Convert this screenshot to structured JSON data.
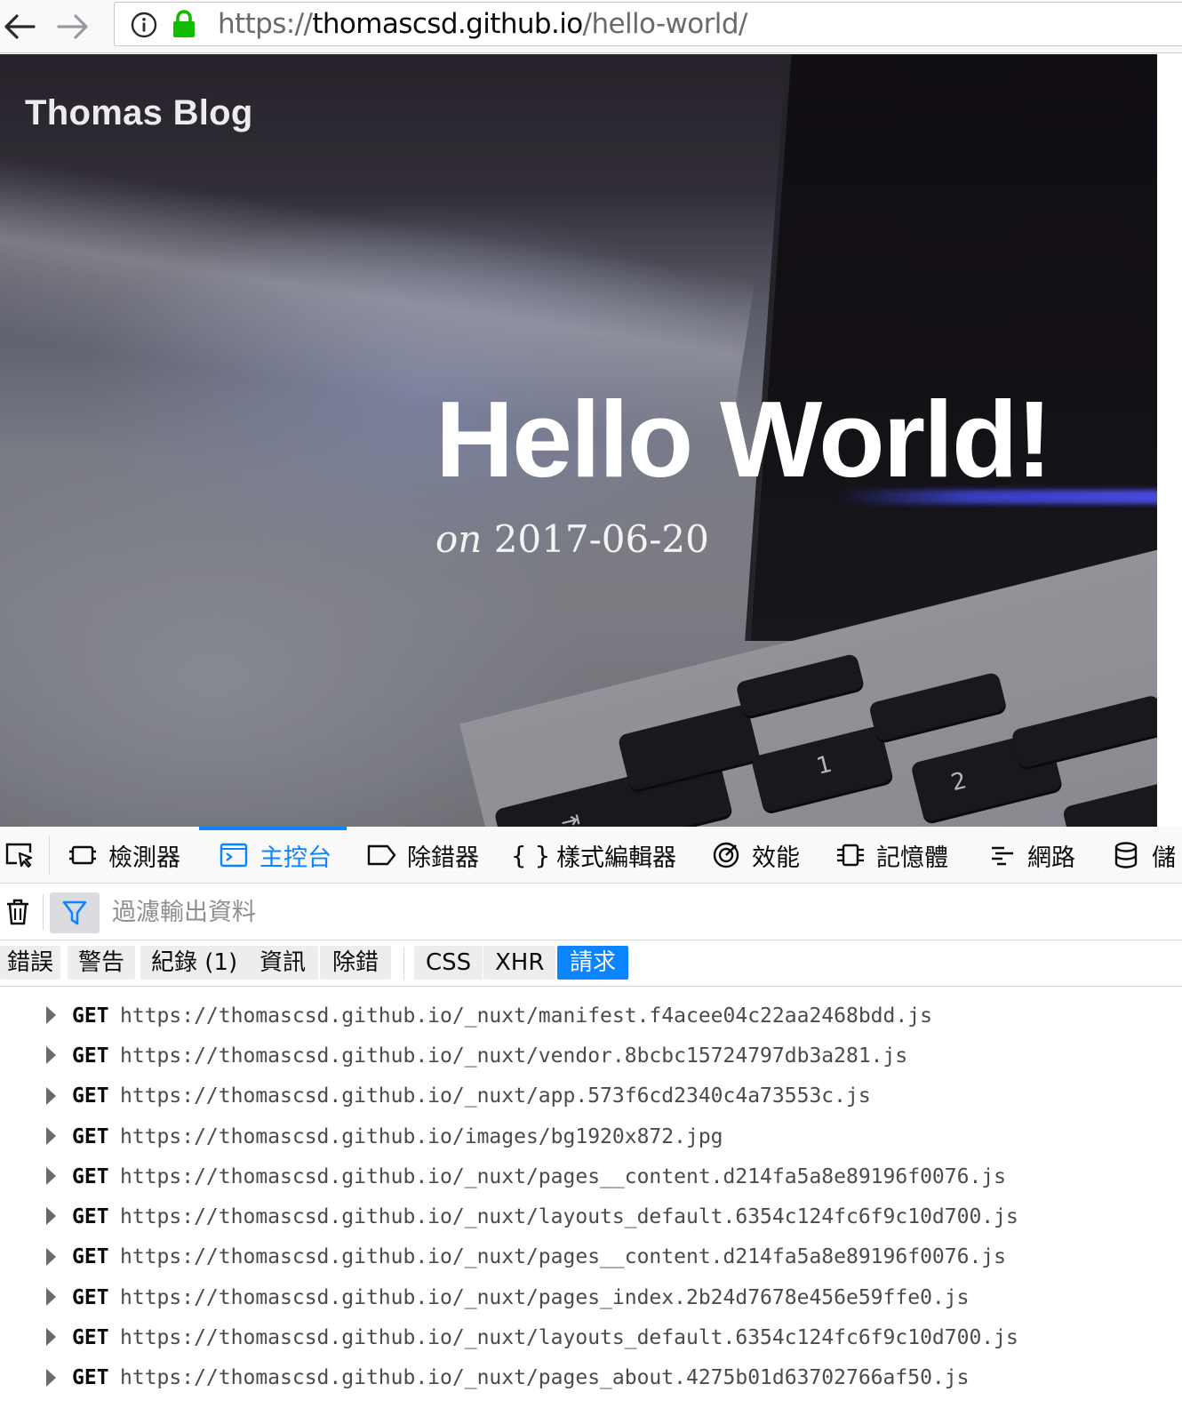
{
  "browser": {
    "url_scheme": "https://",
    "url_domain": "thomascsd.github.io",
    "url_path": "/hello-world/"
  },
  "page": {
    "blog_title": "Thomas Blog",
    "post_title": "Hello World!",
    "date_prefix": "on",
    "date": "2017-06-20"
  },
  "devtools": {
    "tabs": [
      {
        "label": "檢測器",
        "icon": "inspector-icon"
      },
      {
        "label": "主控台",
        "icon": "console-icon",
        "active": true
      },
      {
        "label": "除錯器",
        "icon": "debugger-icon"
      },
      {
        "label": "樣式編輯器",
        "icon": "style-editor-icon"
      },
      {
        "label": "效能",
        "icon": "performance-icon"
      },
      {
        "label": "記憶體",
        "icon": "memory-icon"
      },
      {
        "label": "網路",
        "icon": "network-icon"
      },
      {
        "label": "儲",
        "icon": "storage-icon"
      }
    ],
    "filter_placeholder": "過濾輸出資料",
    "categories": [
      {
        "label": "錯誤",
        "active": false
      },
      {
        "label": "警告",
        "active": false
      },
      {
        "label": "紀錄 (1)",
        "active": false
      },
      {
        "label": "資訊",
        "active": false
      },
      {
        "label": "除錯",
        "active": false
      },
      {
        "label": "CSS",
        "active": false
      },
      {
        "label": "XHR",
        "active": false
      },
      {
        "label": "請求",
        "active": true
      }
    ],
    "active_color": "#0a84ff",
    "log": [
      {
        "method": "GET",
        "url": "https://thomascsd.github.io/_nuxt/manifest.f4acee04c22aa2468bdd.js"
      },
      {
        "method": "GET",
        "url": "https://thomascsd.github.io/_nuxt/vendor.8bcbc15724797db3a281.js"
      },
      {
        "method": "GET",
        "url": "https://thomascsd.github.io/_nuxt/app.573f6cd2340c4a73553c.js"
      },
      {
        "method": "GET",
        "url": "https://thomascsd.github.io/images/bg1920x872.jpg"
      },
      {
        "method": "GET",
        "url": "https://thomascsd.github.io/_nuxt/pages__content.d214fa5a8e89196f0076.js"
      },
      {
        "method": "GET",
        "url": "https://thomascsd.github.io/_nuxt/layouts_default.6354c124fc6f9c10d700.js"
      },
      {
        "method": "GET",
        "url": "https://thomascsd.github.io/_nuxt/pages__content.d214fa5a8e89196f0076.js"
      },
      {
        "method": "GET",
        "url": "https://thomascsd.github.io/_nuxt/pages_index.2b24d7678e456e59ffe0.js"
      },
      {
        "method": "GET",
        "url": "https://thomascsd.github.io/_nuxt/layouts_default.6354c124fc6f9c10d700.js"
      },
      {
        "method": "GET",
        "url": "https://thomascsd.github.io/_nuxt/pages_about.4275b01d63702766af50.js"
      }
    ]
  }
}
